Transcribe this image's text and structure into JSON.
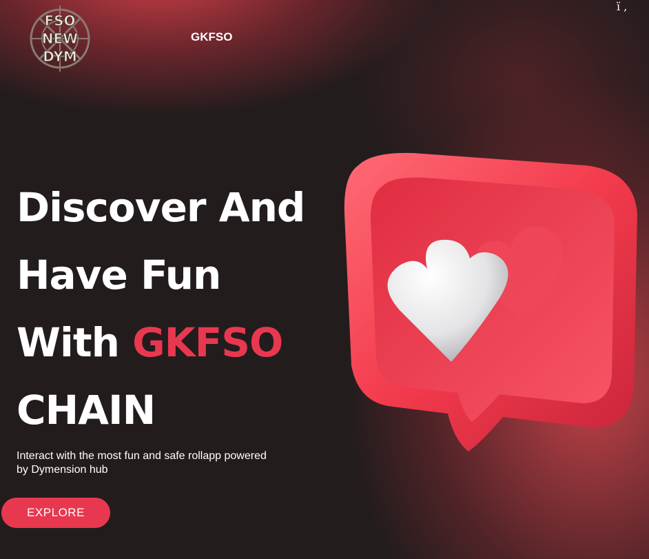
{
  "header": {
    "logo_lines": [
      "FSO",
      "NEW",
      "DYM"
    ],
    "brand": "GKFSO",
    "corner_glyph": "ï ,"
  },
  "hero": {
    "headline_lines": [
      "Discover And",
      "Have Fun"
    ],
    "headline_with": "With",
    "headline_accent": "GKFSO",
    "headline_last": "CHAIN",
    "subtitle": "Interact with the most fun and safe rollapp powered by Dymension hub",
    "cta_label": "EXPLORE"
  },
  "illustration": {
    "icon": "heart-speech-bubble-icon"
  },
  "colors": {
    "accent": "#e8384f",
    "background": "#231c1d",
    "text": "#ffffff"
  }
}
